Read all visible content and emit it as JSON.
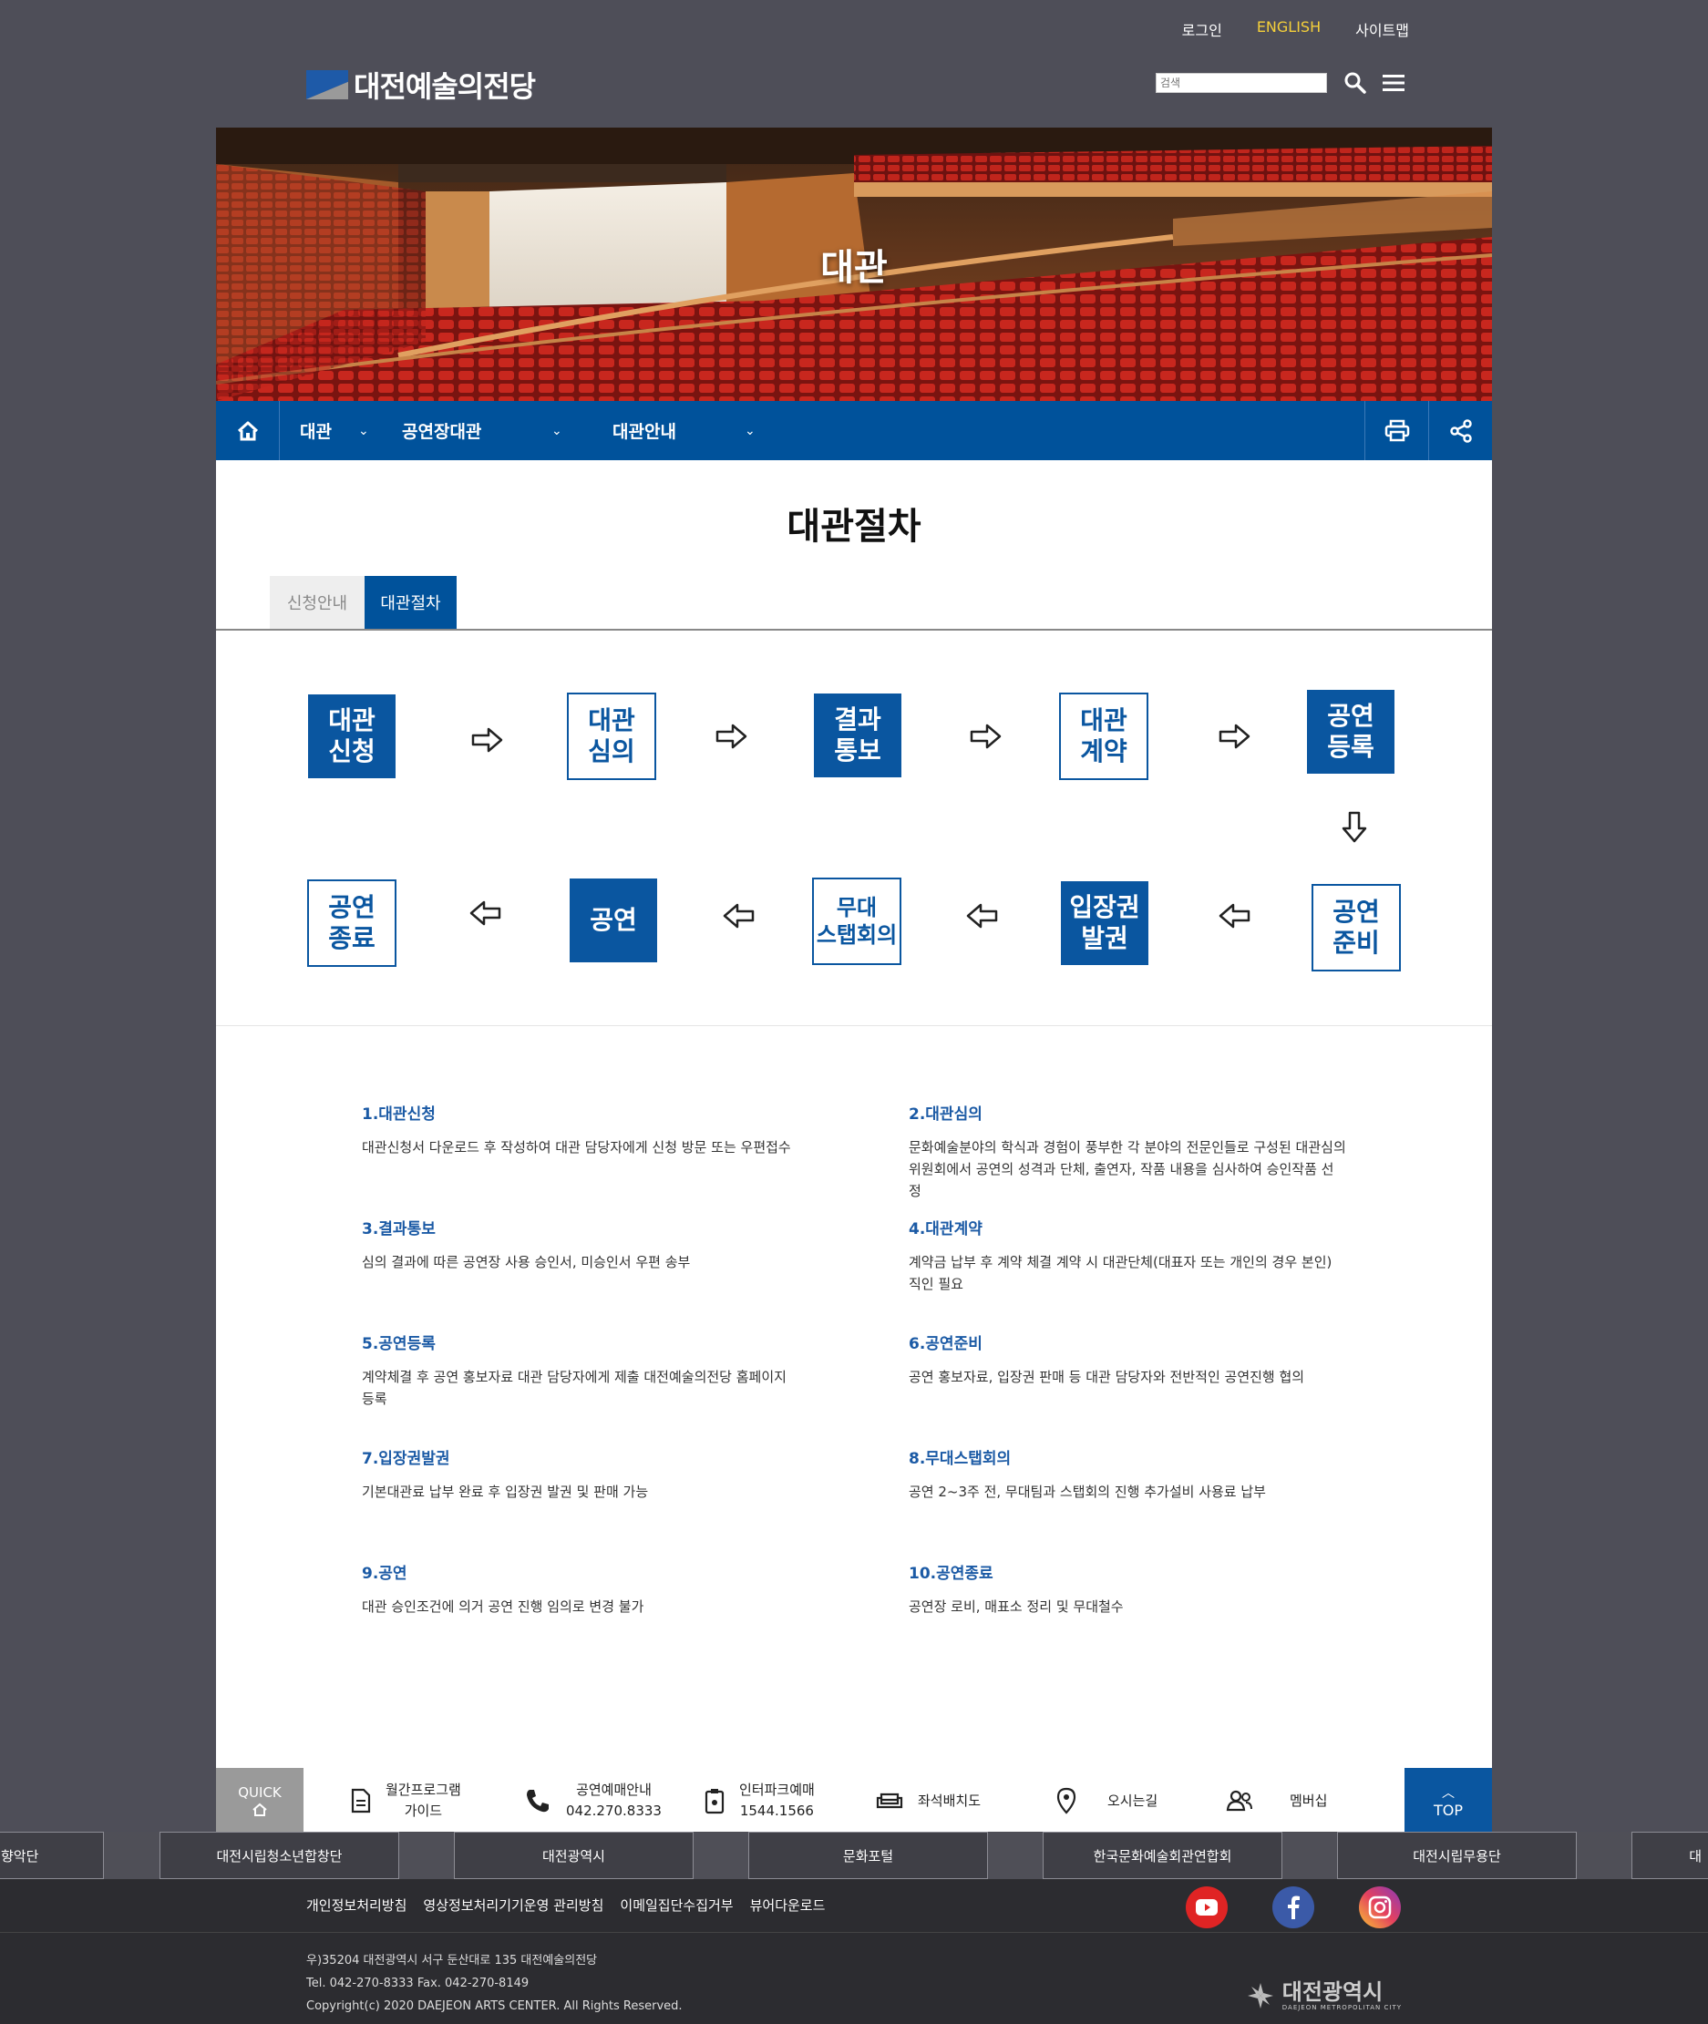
{
  "header": {
    "links": [
      "로그인",
      "ENGLISH",
      "사이트맵"
    ],
    "logo_text": "대전예술의전당",
    "search_placeholder": "검색"
  },
  "hero": {
    "title": "대관"
  },
  "nav": {
    "items": [
      "대관",
      "공연장대관",
      "대관안내"
    ]
  },
  "page": {
    "title": "대관절차",
    "tabs": [
      "신청안내",
      "대관절차"
    ],
    "active_tab": "대관절차"
  },
  "flow": [
    {
      "line1": "대관",
      "line2": "신청",
      "style": "filled"
    },
    {
      "line1": "대관",
      "line2": "심의",
      "style": "outline"
    },
    {
      "line1": "결과",
      "line2": "통보",
      "style": "filled"
    },
    {
      "line1": "대관",
      "line2": "계약",
      "style": "outline"
    },
    {
      "line1": "공연",
      "line2": "등록",
      "style": "filled"
    },
    {
      "line1": "공연",
      "line2": "준비",
      "style": "outline"
    },
    {
      "line1": "입장권",
      "line2": "발권",
      "style": "filled"
    },
    {
      "line1": "무대",
      "line2": "스탭회의",
      "style": "outline"
    },
    {
      "line1": "공연",
      "line2": "",
      "style": "filled"
    },
    {
      "line1": "공연",
      "line2": "종료",
      "style": "outline"
    }
  ],
  "steps": [
    {
      "title": "1.대관신청",
      "desc": "대관신청서 다운로드 후 작성하여 대관 담당자에게 신청 방문 또는 우편접수"
    },
    {
      "title": "2.대관심의",
      "desc": "문화예술분야의 학식과 경험이 풍부한 각 분야의 전문인들로 구성된 대관심의위원회에서 공연의 성격과 단체, 출연자, 작품 내용을 심사하여 승인작품 선정"
    },
    {
      "title": "3.결과통보",
      "desc": "심의 결과에 따른 공연장 사용 승인서, 미승인서 우편 송부"
    },
    {
      "title": "4.대관계약",
      "desc": "계약금 납부 후 계약 체결 계약 시 대관단체(대표자 또는 개인의 경우 본인) 직인 필요"
    },
    {
      "title": "5.공연등록",
      "desc": "계약체결 후 공연 홍보자료 대관 담당자에게 제출 대전예술의전당 홈페이지 등록"
    },
    {
      "title": "6.공연준비",
      "desc": "공연 홍보자료, 입장권 판매 등 대관 담당자와 전반적인 공연진행 협의"
    },
    {
      "title": "7.입장권발권",
      "desc": "기본대관료 납부 완료 후 입장권 발권 및 판매 가능"
    },
    {
      "title": "8.무대스탭회의",
      "desc": "공연 2~3주 전, 무대팀과 스탭회의 진행 추가설비 사용료 납부"
    },
    {
      "title": "9.공연",
      "desc": "대관 승인조건에 의거 공연 진행 임의로 변경 불가"
    },
    {
      "title": "10.공연종료",
      "desc": "공연장 로비, 매표소 정리 및 무대철수"
    }
  ],
  "quick": {
    "label": "QUICK",
    "items": [
      {
        "icon": "document-icon",
        "line1": "월간프로그램",
        "line2": "가이드"
      },
      {
        "icon": "phone-icon",
        "line1": "공연예매안내",
        "line2": "042.270.8333"
      },
      {
        "icon": "ticket-icon",
        "line1": "인터파크예매",
        "line2": "1544.1566"
      },
      {
        "icon": "sofa-icon",
        "line1": "좌석배치도",
        "line2": ""
      },
      {
        "icon": "location-icon",
        "line1": "오시는길",
        "line2": ""
      },
      {
        "icon": "members-icon",
        "line1": "멤버십",
        "line2": ""
      }
    ],
    "top_label": "TOP"
  },
  "family_sites": [
    "향악단",
    "대전시립청소년합창단",
    "대전광역시",
    "문화포털",
    "한국문화예술회관연합회",
    "대전시립무용단",
    "대"
  ],
  "footer": {
    "links": [
      "개인정보처리방침",
      "영상정보처리기기운영 관리방침",
      "이메일집단수집거부",
      "뷰어다운로드"
    ],
    "address": "우)35204 대전광역시 서구 둔산대로 135 대전예술의전당",
    "tel": "Tel. 042-270-8333 Fax. 042-270-8149",
    "copyright": "Copyright(c) 2020 DAEJEON ARTS CENTER. All Rights Reserved.",
    "city_logo": "대전광역시",
    "city_logo_sub": "DAEJEON METROPOLITAN CITY"
  },
  "colors": {
    "primary": "#00529b",
    "page_bg": "#4e4e58",
    "english_link": "#f5d03a"
  }
}
